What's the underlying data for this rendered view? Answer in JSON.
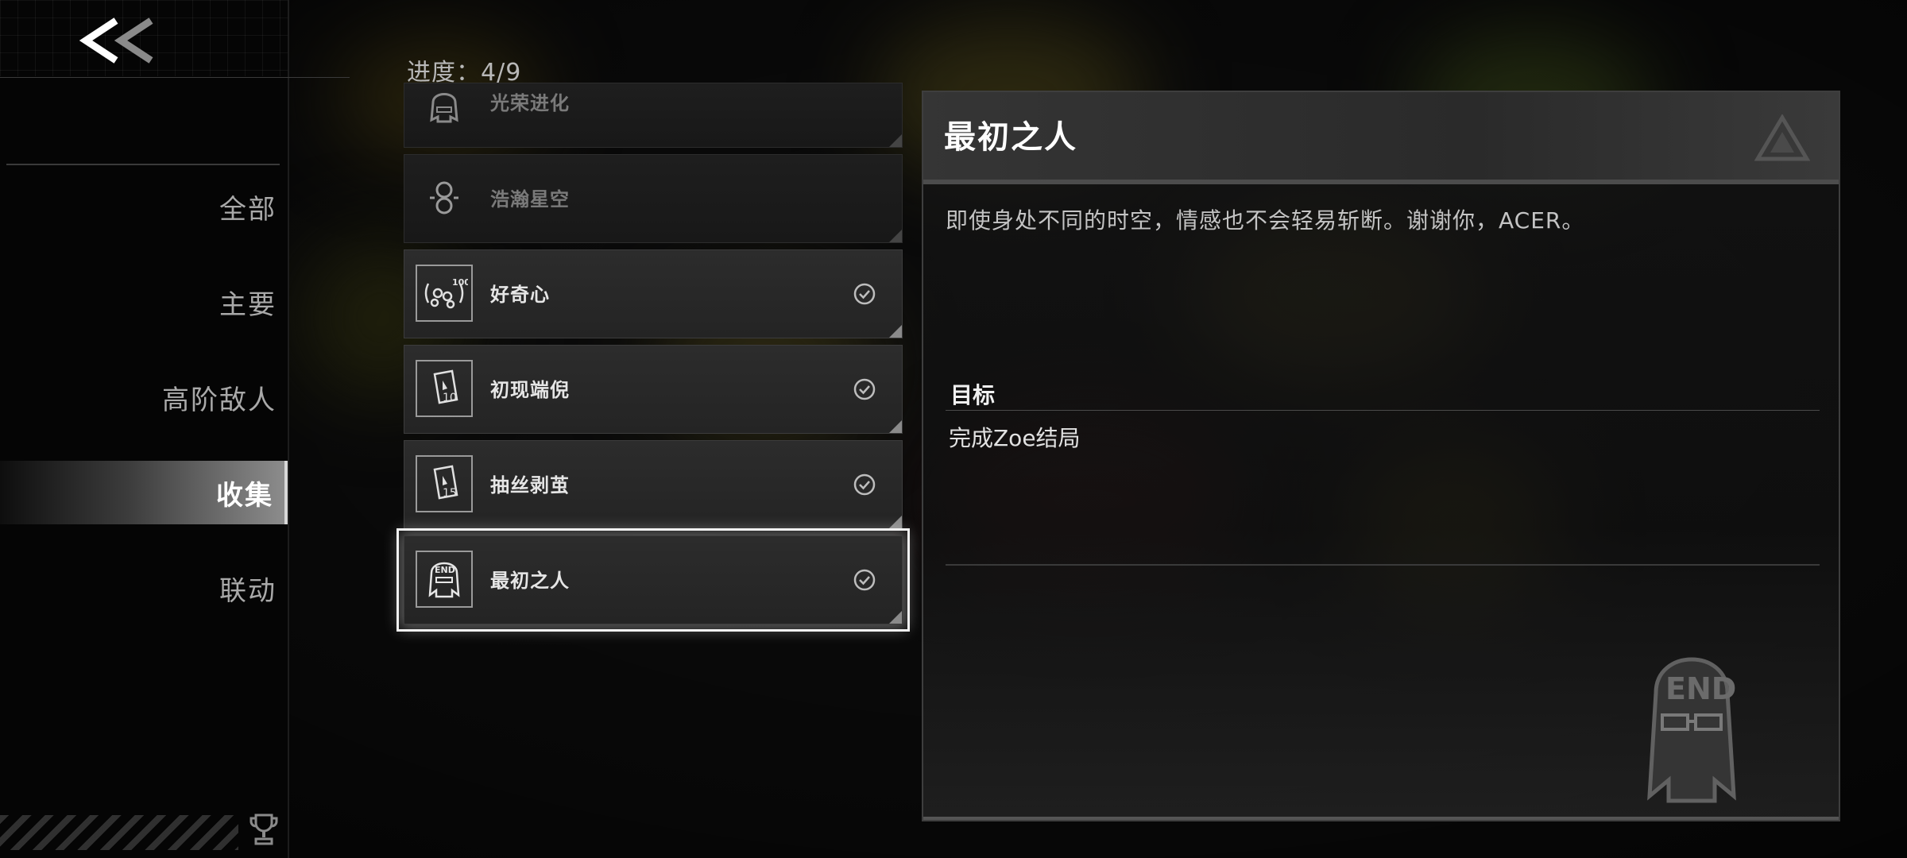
{
  "progress_text": "进度：4/9",
  "nav": {
    "items": [
      {
        "label": "全部",
        "active": false
      },
      {
        "label": "主要",
        "active": false
      },
      {
        "label": "高阶敌人",
        "active": false
      },
      {
        "label": "收集",
        "active": true
      },
      {
        "label": "联动",
        "active": false
      }
    ]
  },
  "achievements": [
    {
      "name": "光荣进化",
      "icon": "end-portrait-icon",
      "unlocked": false
    },
    {
      "name": "浩瀚星空",
      "icon": "link-symbol-icon",
      "unlocked": false
    },
    {
      "name": "好奇心",
      "icon": "curiosity-100-icon",
      "badge": "100",
      "unlocked": true
    },
    {
      "name": "初现端倪",
      "icon": "card-10-icon",
      "badge": "10",
      "unlocked": true
    },
    {
      "name": "抽丝剥茧",
      "icon": "card-15-icon",
      "badge": "15",
      "unlocked": true
    },
    {
      "name": "最初之人",
      "icon": "end-portrait-icon",
      "badge": "END",
      "unlocked": true,
      "selected": true
    }
  ],
  "detail": {
    "title": "最初之人",
    "description": "即使身处不同的时空，情感也不会轻易斩断。谢谢你，ACER。",
    "goal_label": "目标",
    "goal_value": "完成Zoe结局",
    "icon_badge": "END"
  },
  "colors": {
    "background": "#0c0c0c",
    "sidebar": "#050505",
    "selected_outline": "#f2f2f2",
    "text_primary": "#ffffff",
    "text_secondary": "#a9a9a9"
  }
}
